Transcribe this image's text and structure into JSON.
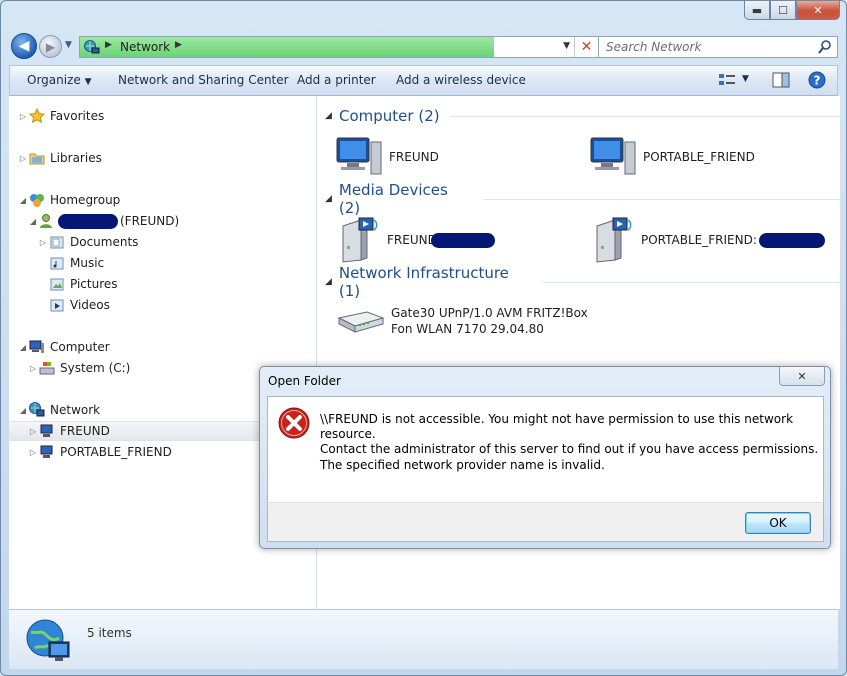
{
  "window": {
    "caption": {
      "minimize": "▬",
      "maximize": "☐",
      "close": "✕"
    }
  },
  "address": {
    "crumb": "Network",
    "progress_percent": 80
  },
  "search": {
    "placeholder": "Search Network"
  },
  "toolbar": {
    "organize": "Organize",
    "network_sharing": "Network and Sharing Center",
    "add_printer": "Add a printer",
    "add_wireless": "Add a wireless device"
  },
  "nav": {
    "favorites": "Favorites",
    "libraries": "Libraries",
    "homegroup": "Homegroup",
    "homegroup_user": "(FREUND)",
    "documents": "Documents",
    "music": "Music",
    "pictures": "Pictures",
    "videos": "Videos",
    "computer": "Computer",
    "system_c": "System (C:)",
    "network": "Network",
    "freund": "FREUND",
    "portable_friend": "PORTABLE_FRIEND"
  },
  "content": {
    "groups": {
      "computer": "Computer (2)",
      "media": "Media Devices (2)",
      "infra": "Network Infrastructure (1)"
    },
    "computers": [
      "FREUND",
      "PORTABLE_FRIEND"
    ],
    "media": [
      "FREUND",
      "PORTABLE_FRIEND:"
    ],
    "infra_line1": "Gate30 UPnP/1.0 AVM FRITZ!Box",
    "infra_line2": "Fon WLAN 7170 29.04.80"
  },
  "details": {
    "count": "5 items"
  },
  "dialog": {
    "title": "Open Folder",
    "message_line1": "\\\\FREUND is not accessible. You might not have permission to use this network resource.",
    "message_line2": "Contact the administrator of this server to find out if you have access permissions.",
    "message_detail": "The specified network provider name is invalid.",
    "ok": "OK",
    "close": "✕"
  },
  "colors": {
    "accent_blue": "#1e4e8e",
    "error_red": "#c8231b",
    "redaction": "#041774",
    "progress_green": "#6cd476"
  }
}
